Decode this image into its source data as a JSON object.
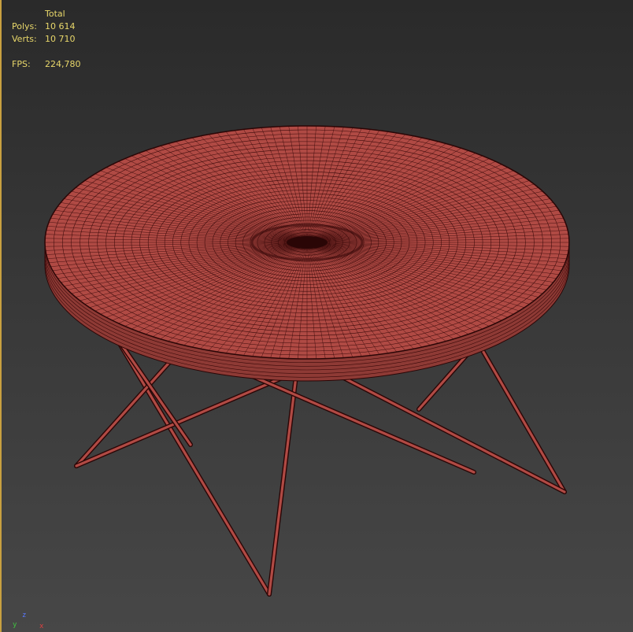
{
  "stats": {
    "header": "Total",
    "polys_label": "Polys:",
    "polys_value": "10 614",
    "verts_label": "Verts:",
    "verts_value": "10 710",
    "fps_label": "FPS:",
    "fps_value": "224,780"
  },
  "gizmo": {
    "z": "z",
    "y": "y",
    "x": "x"
  },
  "colors": {
    "mesh_fill": "#b04a44",
    "wire": "#3a0a0a",
    "stats_text": "#e8d76a",
    "border_accent": "#c8a040"
  }
}
